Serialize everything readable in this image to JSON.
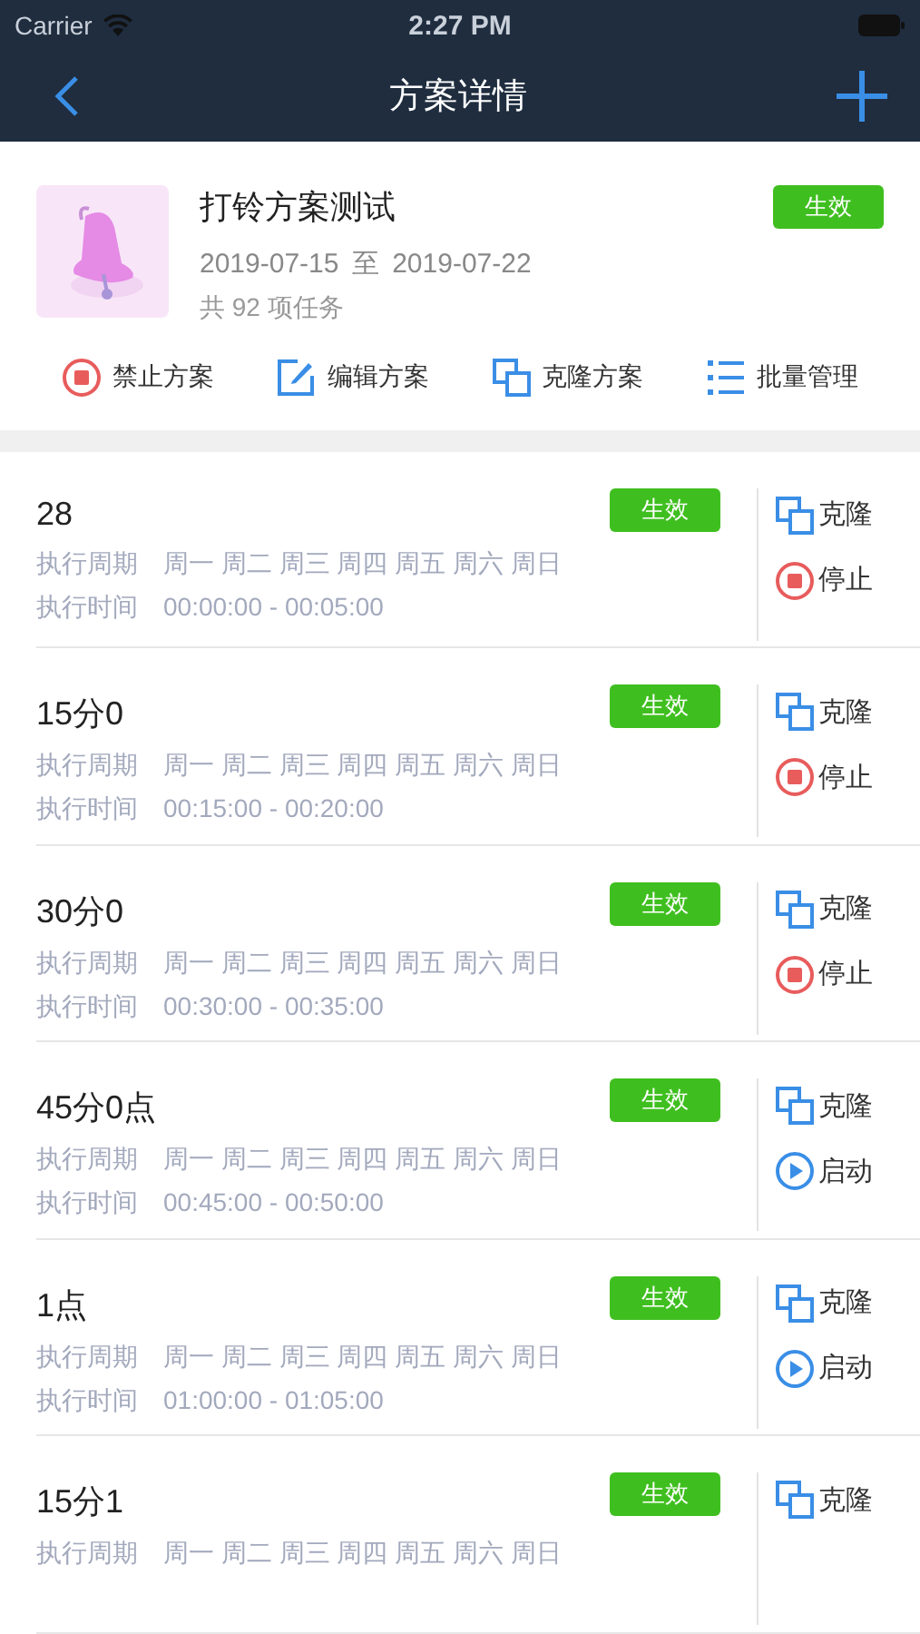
{
  "status_bar": {
    "carrier": "Carrier",
    "time": "2:27 PM"
  },
  "nav": {
    "title": "方案详情"
  },
  "plan": {
    "name": "打铃方案测试",
    "status": {
      "kind": "active",
      "label": "生效"
    },
    "start": "2019-07-15",
    "separator": "至",
    "end": "2019-07-22",
    "count": "共 92 项任务",
    "actions": [
      {
        "kind": "disable",
        "label": "禁止方案"
      },
      {
        "kind": "edit",
        "label": "编辑方案"
      },
      {
        "kind": "clone",
        "label": "克隆方案"
      },
      {
        "kind": "batch",
        "label": "批量管理"
      }
    ]
  },
  "tasks": [
    {
      "name": "28",
      "status": {
        "kind": "active",
        "label": "生效"
      },
      "period_label": "执行周期",
      "period": "周一 周二 周三 周四 周五 周六 周日",
      "time_label": "执行时间",
      "time": "00:00:00 - 00:05:00",
      "clone": "克隆",
      "action": {
        "kind": "stop",
        "label": "停止"
      }
    },
    {
      "name": "15分0",
      "status": {
        "kind": "active",
        "label": "生效"
      },
      "period_label": "执行周期",
      "period": "周一 周二 周三 周四 周五 周六 周日",
      "time_label": "执行时间",
      "time": "00:15:00 - 00:20:00",
      "clone": "克隆",
      "action": {
        "kind": "stop",
        "label": "停止"
      }
    },
    {
      "name": "30分0",
      "status": {
        "kind": "active",
        "label": "生效"
      },
      "period_label": "执行周期",
      "period": "周一 周二 周三 周四 周五 周六 周日",
      "time_label": "执行时间",
      "time": "00:30:00 - 00:35:00",
      "clone": "克隆",
      "action": {
        "kind": "stop",
        "label": "停止"
      }
    },
    {
      "name": "45分0点",
      "status": {
        "kind": "active",
        "label": "生效"
      },
      "period_label": "执行周期",
      "period": "周一 周二 周三 周四 周五 周六 周日",
      "time_label": "执行时间",
      "time": "00:45:00 - 00:50:00",
      "clone": "克隆",
      "action": {
        "kind": "start",
        "label": "启动"
      }
    },
    {
      "name": "1点",
      "status": {
        "kind": "active",
        "label": "生效"
      },
      "period_label": "执行周期",
      "period": "周一 周二 周三 周四 周五 周六 周日",
      "time_label": "执行时间",
      "time": "01:00:00 - 01:05:00",
      "clone": "克隆",
      "action": {
        "kind": "start",
        "label": "启动"
      }
    },
    {
      "name": "15分1",
      "status": {
        "kind": "active",
        "label": "生效"
      },
      "period_label": "执行周期",
      "period": "周一 周二 周三 周四 周五 周六 周日",
      "clone": "克隆"
    }
  ]
}
